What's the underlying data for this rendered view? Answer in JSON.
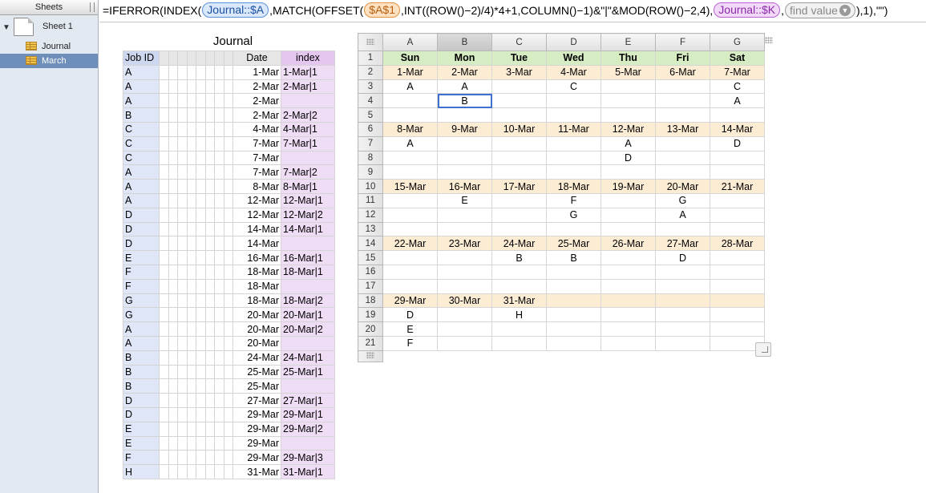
{
  "sidebar": {
    "header": "Sheets",
    "sheet": "Sheet 1",
    "tables": [
      "Journal",
      "March"
    ],
    "selected_table": "March"
  },
  "formula": {
    "prefix": "=IFERROR(INDEX(",
    "tok1": "Journal::$A",
    "mid1": ",MATCH(OFFSET(",
    "tok2": "$A$1",
    "mid2": ",INT((ROW()−2)/4)*4+1,COLUMN()−1)&\"|\"&MOD(ROW()−2,4),",
    "tok3": "Journal::$K",
    "mid3": ",",
    "tok4": "find value",
    "suffix": "),1),\"\")"
  },
  "journal": {
    "title": "Journal",
    "headers": {
      "job": "Job ID",
      "date": "Date",
      "index": "index"
    },
    "rows": [
      [
        "A",
        "1-Mar",
        "1-Mar|1"
      ],
      [
        "A",
        "2-Mar",
        "2-Mar|1"
      ],
      [
        "A",
        "2-Mar",
        ""
      ],
      [
        "B",
        "2-Mar",
        "2-Mar|2"
      ],
      [
        "C",
        "4-Mar",
        "4-Mar|1"
      ],
      [
        "C",
        "7-Mar",
        "7-Mar|1"
      ],
      [
        "C",
        "7-Mar",
        ""
      ],
      [
        "A",
        "7-Mar",
        "7-Mar|2"
      ],
      [
        "A",
        "8-Mar",
        "8-Mar|1"
      ],
      [
        "A",
        "12-Mar",
        "12-Mar|1"
      ],
      [
        "D",
        "12-Mar",
        "12-Mar|2"
      ],
      [
        "D",
        "14-Mar",
        "14-Mar|1"
      ],
      [
        "D",
        "14-Mar",
        ""
      ],
      [
        "E",
        "16-Mar",
        "16-Mar|1"
      ],
      [
        "F",
        "18-Mar",
        "18-Mar|1"
      ],
      [
        "F",
        "18-Mar",
        ""
      ],
      [
        "G",
        "18-Mar",
        "18-Mar|2"
      ],
      [
        "G",
        "20-Mar",
        "20-Mar|1"
      ],
      [
        "A",
        "20-Mar",
        "20-Mar|2"
      ],
      [
        "A",
        "20-Mar",
        ""
      ],
      [
        "B",
        "24-Mar",
        "24-Mar|1"
      ],
      [
        "B",
        "25-Mar",
        "25-Mar|1"
      ],
      [
        "B",
        "25-Mar",
        ""
      ],
      [
        "D",
        "27-Mar",
        "27-Mar|1"
      ],
      [
        "D",
        "29-Mar",
        "29-Mar|1"
      ],
      [
        "E",
        "29-Mar",
        "29-Mar|2"
      ],
      [
        "E",
        "29-Mar",
        ""
      ],
      [
        "F",
        "29-Mar",
        "29-Mar|3"
      ],
      [
        "H",
        "31-Mar",
        "31-Mar|1"
      ]
    ]
  },
  "march": {
    "columns": [
      "A",
      "B",
      "C",
      "D",
      "E",
      "F",
      "G"
    ],
    "active_column": "B",
    "selected_cell": "B4",
    "rows": [
      [
        "Sun",
        "Mon",
        "Tue",
        "Wed",
        "Thu",
        "Fri",
        "Sat"
      ],
      [
        "1-Mar",
        "2-Mar",
        "3-Mar",
        "4-Mar",
        "5-Mar",
        "6-Mar",
        "7-Mar"
      ],
      [
        "A",
        "A",
        "",
        "C",
        "",
        "",
        "C"
      ],
      [
        "",
        "B",
        "",
        "",
        "",
        "",
        "A"
      ],
      [
        "",
        "",
        "",
        "",
        "",
        "",
        ""
      ],
      [
        "8-Mar",
        "9-Mar",
        "10-Mar",
        "11-Mar",
        "12-Mar",
        "13-Mar",
        "14-Mar"
      ],
      [
        "A",
        "",
        "",
        "",
        "A",
        "",
        "D"
      ],
      [
        "",
        "",
        "",
        "",
        "D",
        "",
        ""
      ],
      [
        "",
        "",
        "",
        "",
        "",
        "",
        ""
      ],
      [
        "15-Mar",
        "16-Mar",
        "17-Mar",
        "18-Mar",
        "19-Mar",
        "20-Mar",
        "21-Mar"
      ],
      [
        "",
        "E",
        "",
        "F",
        "",
        "G",
        ""
      ],
      [
        "",
        "",
        "",
        "G",
        "",
        "A",
        ""
      ],
      [
        "",
        "",
        "",
        "",
        "",
        "",
        ""
      ],
      [
        "22-Mar",
        "23-Mar",
        "24-Mar",
        "25-Mar",
        "26-Mar",
        "27-Mar",
        "28-Mar"
      ],
      [
        "",
        "",
        "B",
        "B",
        "",
        "D",
        ""
      ],
      [
        "",
        "",
        "",
        "",
        "",
        "",
        ""
      ],
      [
        "",
        "",
        "",
        "",
        "",
        "",
        ""
      ],
      [
        "29-Mar",
        "30-Mar",
        "31-Mar",
        "",
        "",
        "",
        ""
      ],
      [
        "D",
        "",
        "H",
        "",
        "",
        "",
        ""
      ],
      [
        "E",
        "",
        "",
        "",
        "",
        "",
        ""
      ],
      [
        "F",
        "",
        "",
        "",
        "",
        "",
        ""
      ]
    ],
    "colors": {
      "day_header": "#d6ecc2",
      "date_row": "#fdecd4",
      "selection": "#3e6fd1"
    }
  },
  "icons": [
    "disclosure-triangle-icon",
    "sheet-icon",
    "table-icon",
    "grip-icon",
    "resize-handle-icon",
    "dropdown-icon"
  ]
}
